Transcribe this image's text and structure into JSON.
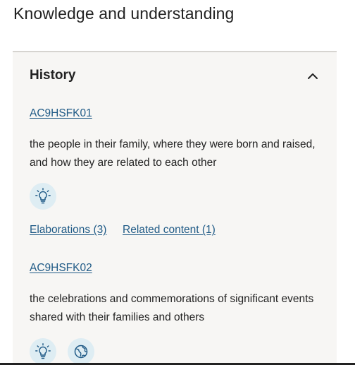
{
  "section": {
    "title": "Knowledge and understanding"
  },
  "accordion": {
    "title": "History",
    "state": "expanded",
    "toggle_icon": "chevron-up-icon"
  },
  "items": [
    {
      "code": "AC9HSFK01",
      "description_line1": "the people in their family, where they were born and raised,",
      "description_line2": "and how they are related to each other",
      "icons": [
        "lightbulb-icon"
      ],
      "elaborations_label": "Elaborations (3)",
      "related_label": "Related content (1)"
    },
    {
      "code": "AC9HSFK02",
      "description_line1": "the celebrations and commemorations of significant events",
      "description_line2": "shared with their families and others",
      "icons": [
        "lightbulb-icon",
        "globe-icon"
      ]
    }
  ],
  "colors": {
    "link": "#1f5a86",
    "panel_bg": "#f7f6f4",
    "icon_bg": "#deedf3",
    "icon_stroke": "#1f5a86"
  }
}
